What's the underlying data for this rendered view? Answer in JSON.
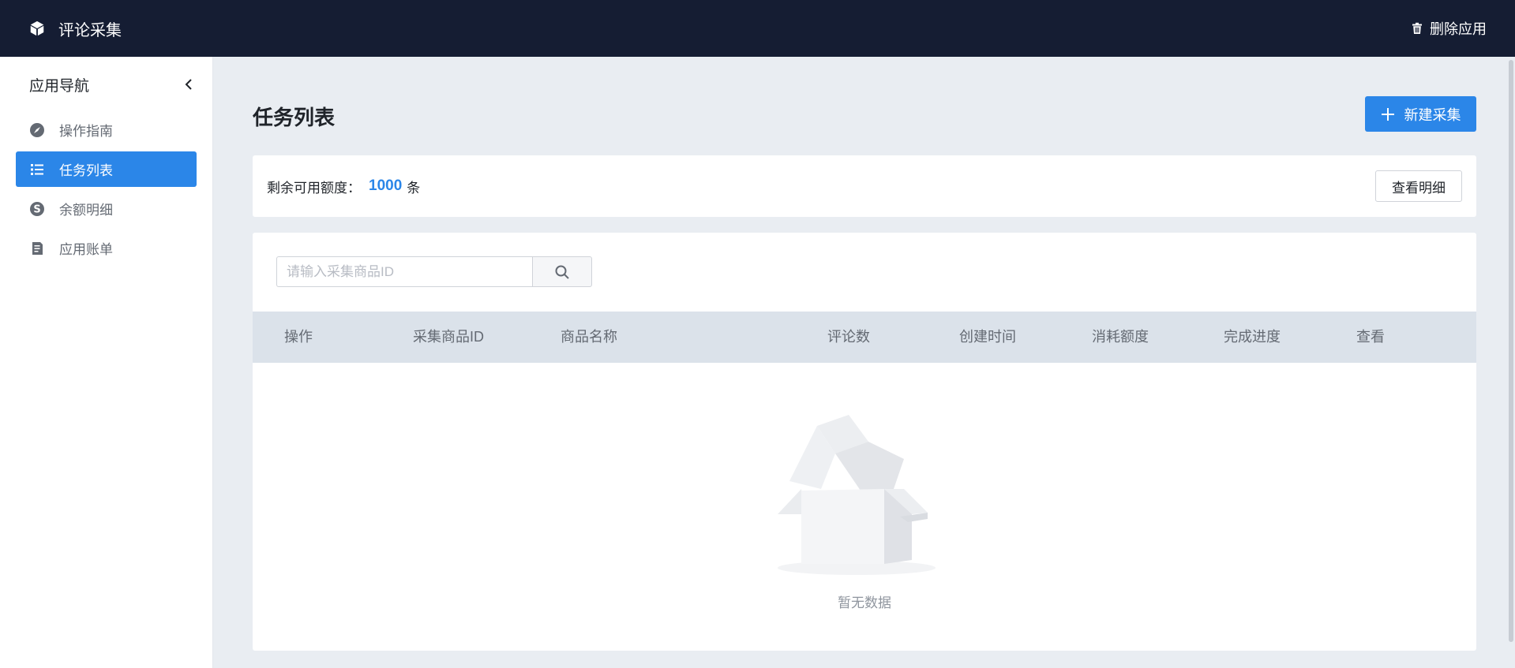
{
  "header": {
    "app_title": "评论采集",
    "delete_label": "删除应用",
    "icons": {
      "app": "cube-icon",
      "delete": "trash-icon"
    }
  },
  "sidebar": {
    "title": "应用导航",
    "collapse_icon": "chevron-left-icon",
    "items": [
      {
        "label": "操作指南",
        "icon": "compass-icon",
        "active": false
      },
      {
        "label": "任务列表",
        "icon": "list-icon",
        "active": true
      },
      {
        "label": "余额明细",
        "icon": "dollar-icon",
        "active": false
      },
      {
        "label": "应用账单",
        "icon": "document-icon",
        "active": false
      }
    ]
  },
  "main": {
    "page_title": "任务列表",
    "new_button_label": "新建采集",
    "quota": {
      "label": "剩余可用额度：",
      "value": "1000",
      "unit": "条",
      "detail_button": "查看明细"
    },
    "search": {
      "placeholder": "请输入采集商品ID",
      "value": ""
    },
    "table": {
      "columns": [
        "操作",
        "采集商品ID",
        "商品名称",
        "评论数",
        "创建时间",
        "消耗额度",
        "完成进度",
        "查看"
      ],
      "rows": [],
      "empty_text": "暂无数据"
    }
  },
  "colors": {
    "topbar_bg": "#151d33",
    "accent": "#2b86e8",
    "page_bg": "#e9edf2",
    "table_header_bg": "#dbe2ea"
  }
}
